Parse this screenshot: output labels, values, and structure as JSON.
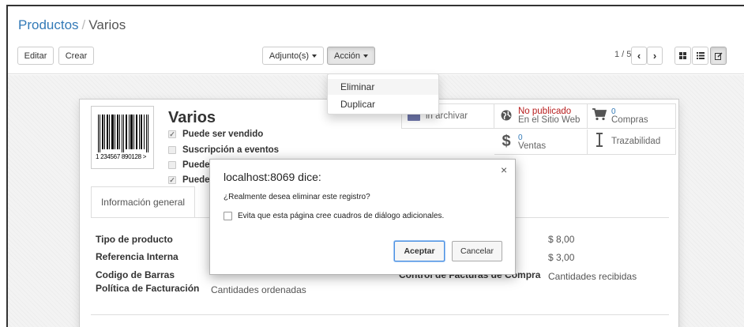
{
  "breadcrumb": {
    "parent": "Productos",
    "separator": "/",
    "current": "Varios"
  },
  "toolbar": {
    "edit_label": "Editar",
    "create_label": "Crear",
    "attachments_label": "Adjunto(s)",
    "action_label": "Acción"
  },
  "pager": {
    "value": "1 / 5"
  },
  "action_menu": {
    "items": [
      {
        "label": "Eliminar"
      },
      {
        "label": "Duplicar"
      }
    ]
  },
  "product": {
    "barcode_digits": "1 234567 890128 >",
    "name": "Varios",
    "checkboxes": [
      {
        "label": "Puede ser vendido",
        "checked": true
      },
      {
        "label": "Suscripción a eventos",
        "checked": false
      },
      {
        "label": "Puede",
        "checked": false
      },
      {
        "label": "Puede",
        "checked": true
      }
    ]
  },
  "stat_buttons": {
    "archive": {
      "label": "Sin archivar",
      "visible_label": "in archivar"
    },
    "website": {
      "line1": "No publicado",
      "line2": "En el Sitio Web"
    },
    "purchases": {
      "count": "0",
      "label": "Compras"
    },
    "sales": {
      "count": "0",
      "label": "Ventas"
    },
    "traceability": {
      "label": "Trazabilidad"
    }
  },
  "tabs": [
    {
      "label": "Información general",
      "active": true
    }
  ],
  "fields": {
    "left": [
      {
        "label": "Tipo de producto",
        "value": ""
      },
      {
        "label": "Referencia Interna",
        "value": ""
      },
      {
        "label": "Codigo de Barras",
        "value": ""
      },
      {
        "label": "Política de Facturación",
        "value": "Cantidades ordenadas"
      }
    ],
    "right": [
      {
        "label": "",
        "value": "$ 8,00"
      },
      {
        "label": "",
        "value": "$ 3,00"
      },
      {
        "label": "Control de Facturas de Compra",
        "value": "Cantidades recibidas"
      }
    ]
  },
  "dialog": {
    "title": "localhost:8069 dice:",
    "message": "¿Realmente desea eliminar este registro?",
    "checkbox_label": "Evita que esta página cree cuadros de diálogo adicionales.",
    "ok_label": "Aceptar",
    "cancel_label": "Cancelar"
  },
  "colors": {
    "link": "#337ab7",
    "unpublished": "#b71c1c",
    "dialog_focus": "#4a90e2"
  },
  "icons": {
    "prev": "chevron-left-icon",
    "next": "chevron-right-icon",
    "kanban": "kanban-view-icon",
    "list": "list-view-icon",
    "form": "form-view-icon",
    "globe": "globe-icon",
    "cart": "cart-icon",
    "dollar": "dollar-icon",
    "trace": "traceability-icon"
  }
}
